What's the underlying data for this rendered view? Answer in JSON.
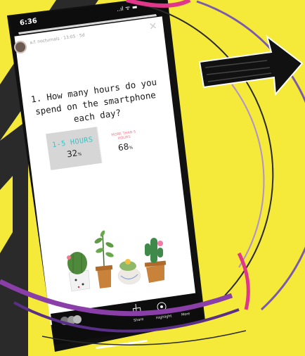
{
  "status_bar": {
    "time": "6:36",
    "indicators": "..ıl ᯤ ▬"
  },
  "story_header": {
    "username": "a.f. nocturnals · 13:05 ‧ 5d"
  },
  "poll": {
    "question": "1. How many hours do you spend on the smartphone each day?",
    "options": [
      {
        "label": "1-5 HOURS",
        "percent": "32",
        "percent_sign": "%"
      },
      {
        "label": "MORE THAN 5 HOURS",
        "percent": "68",
        "percent_sign": "%"
      }
    ]
  },
  "footer": {
    "share_label": "Share",
    "highlight_label": "Highlight",
    "more_label": "More",
    "share_icon": "share-icon",
    "highlight_icon": "heart-icon",
    "more_icon": "more-icon"
  },
  "colors": {
    "background_yellow": "#f5e93a",
    "dark_stripe": "#2a2a2a",
    "accent_purple": "#7a3f9e",
    "accent_magenta": "#e0378a",
    "poll_teal": "#2fc7c9",
    "poll_pink": "#f07a8c"
  },
  "icons": [
    "arrow-right-icon",
    "cactus-illustration"
  ]
}
